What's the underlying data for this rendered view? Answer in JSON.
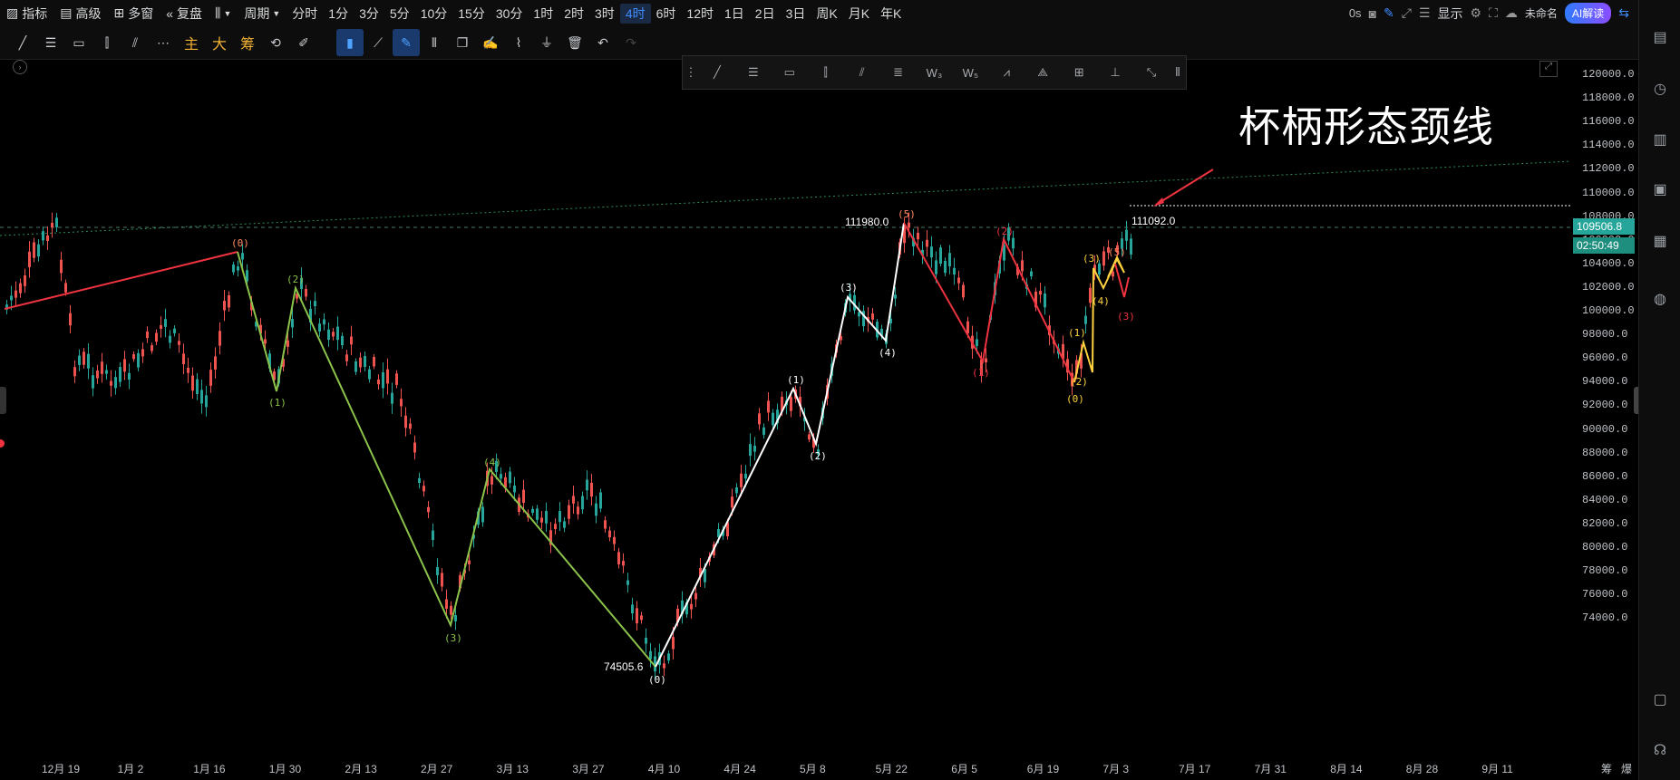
{
  "topbar": {
    "indicator": "指标",
    "advanced": "高级",
    "multi_window": "多窗",
    "replay": "复盘",
    "period": "周期",
    "periods": [
      "分时",
      "1分",
      "3分",
      "5分",
      "10分",
      "15分",
      "30分",
      "1时",
      "2时",
      "3时",
      "4时",
      "6时",
      "12时",
      "1日",
      "2日",
      "3日",
      "周K",
      "月K",
      "年K"
    ],
    "active_period": "4时",
    "countdown": "0s",
    "display": "显示",
    "unnamed": "未命名",
    "ai": "AI解读"
  },
  "toolbar": {
    "main": "主",
    "big": "大",
    "chip": "筹"
  },
  "chart": {
    "annotation": "杯柄形态颈线",
    "high_label": "111980.0",
    "low_label": "74505.6",
    "level_label": "111092.0",
    "current_price": "109506.8",
    "countdown": "02:50:49"
  },
  "yaxis": {
    "ticks": [
      "120000.0",
      "118000.0",
      "116000.0",
      "114000.0",
      "112000.0",
      "110000.0",
      "108000.0",
      "106000.0",
      "104000.0",
      "102000.0",
      "100000.0",
      "98000.0",
      "96000.0",
      "94000.0",
      "92000.0",
      "90000.0",
      "88000.0",
      "86000.0",
      "84000.0",
      "82000.0",
      "80000.0",
      "78000.0",
      "76000.0",
      "74000.0"
    ]
  },
  "xaxis": {
    "ticks": [
      "12月 19",
      "1月 2",
      "1月 16",
      "1月 30",
      "2月 13",
      "2月 27",
      "3月 13",
      "3月 27",
      "4月 10",
      "4月 24",
      "5月 8",
      "5月 22",
      "6月 5",
      "6月 19",
      "7月 3",
      "7月 17",
      "7月 31",
      "8月 14",
      "8月 28",
      "9月 11"
    ],
    "right_labels": [
      "筹",
      "爆"
    ]
  },
  "waves": {
    "green": [
      "(0)",
      "(1)",
      "(2)",
      "(3)",
      "(4)"
    ],
    "white": [
      "(0)",
      "(1)",
      "(2)",
      "(3)",
      "(4)",
      "(5)"
    ],
    "red": [
      "(1)",
      "(2)",
      "(3)"
    ],
    "yellow": [
      "(0)",
      "(1)",
      "(2)",
      "(3)",
      "(4)",
      "(5)"
    ]
  },
  "colors": {
    "up": "#26a69a",
    "down": "#ef5350",
    "green_wave": "#8bc34a",
    "white_wave": "#ffffff",
    "red_wave": "#ef3340",
    "yellow_wave": "#ffd23f",
    "accent": "#3f8cff",
    "price_tag": "#26a69a"
  }
}
